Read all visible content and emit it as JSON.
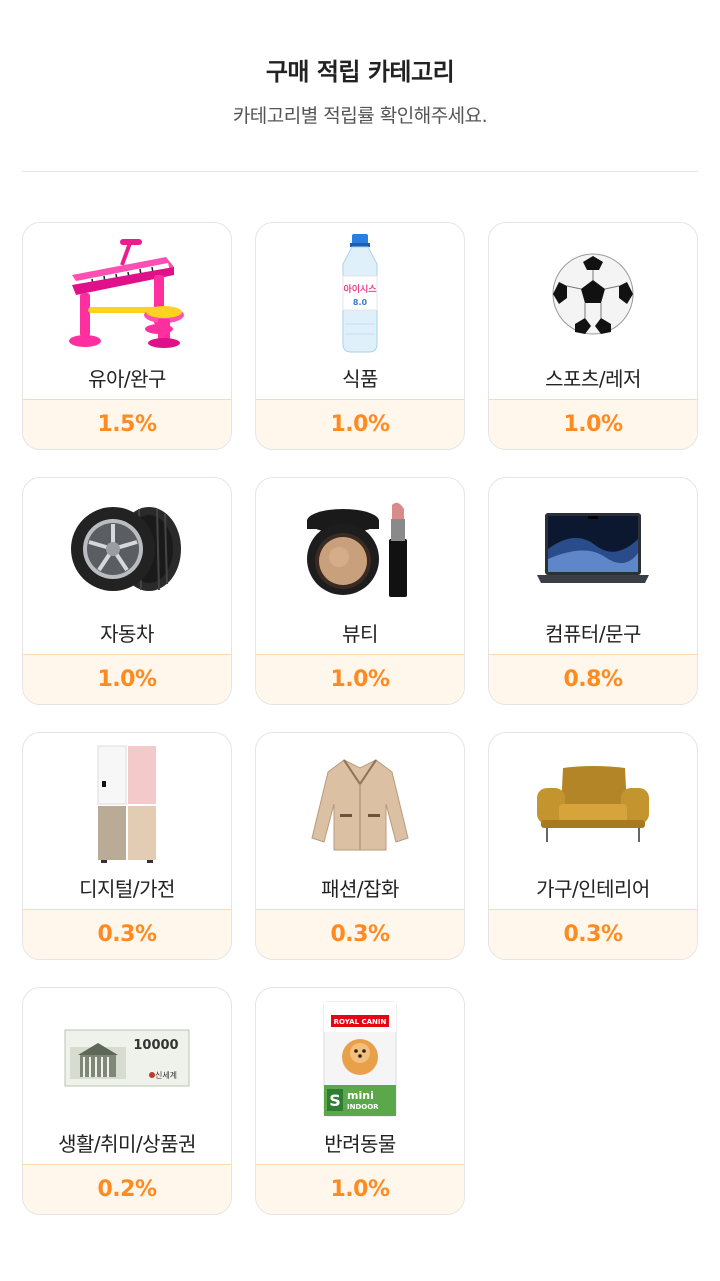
{
  "header": {
    "title": "구매 적립 카테고리",
    "subtitle": "카테고리별 적립률 확인해주세요."
  },
  "categories": [
    {
      "name": "유아/완구",
      "rate": "1.5%",
      "icon": "toy-piano-icon"
    },
    {
      "name": "식품",
      "rate": "1.0%",
      "icon": "water-bottle-icon"
    },
    {
      "name": "스포츠/레저",
      "rate": "1.0%",
      "icon": "soccer-ball-icon"
    },
    {
      "name": "자동차",
      "rate": "1.0%",
      "icon": "tire-icon"
    },
    {
      "name": "뷰티",
      "rate": "1.0%",
      "icon": "cosmetics-icon"
    },
    {
      "name": "컴퓨터/문구",
      "rate": "0.8%",
      "icon": "laptop-icon"
    },
    {
      "name": "디지털/가전",
      "rate": "0.3%",
      "icon": "refrigerator-icon"
    },
    {
      "name": "패션/잡화",
      "rate": "0.3%",
      "icon": "fleece-jacket-icon"
    },
    {
      "name": "가구/인테리어",
      "rate": "0.3%",
      "icon": "armchair-icon"
    },
    {
      "name": "생활/취미/상품권",
      "rate": "0.2%",
      "icon": "gift-voucher-icon"
    },
    {
      "name": "반려동물",
      "rate": "1.0%",
      "icon": "dog-food-bag-icon"
    }
  ],
  "product_text": {
    "water_brand": "아이시스",
    "water_size": "8.0",
    "voucher_amount": "10000",
    "voucher_brand": "신세계",
    "dogfood_brand": "ROYAL CANIN",
    "dogfood_size": "S",
    "dogfood_line": "mini",
    "dogfood_variant": "INDOOR"
  },
  "colors": {
    "accent": "#ff8a1f",
    "rate_bg": "#fff6ec",
    "card_border": "#e4e4e4"
  }
}
